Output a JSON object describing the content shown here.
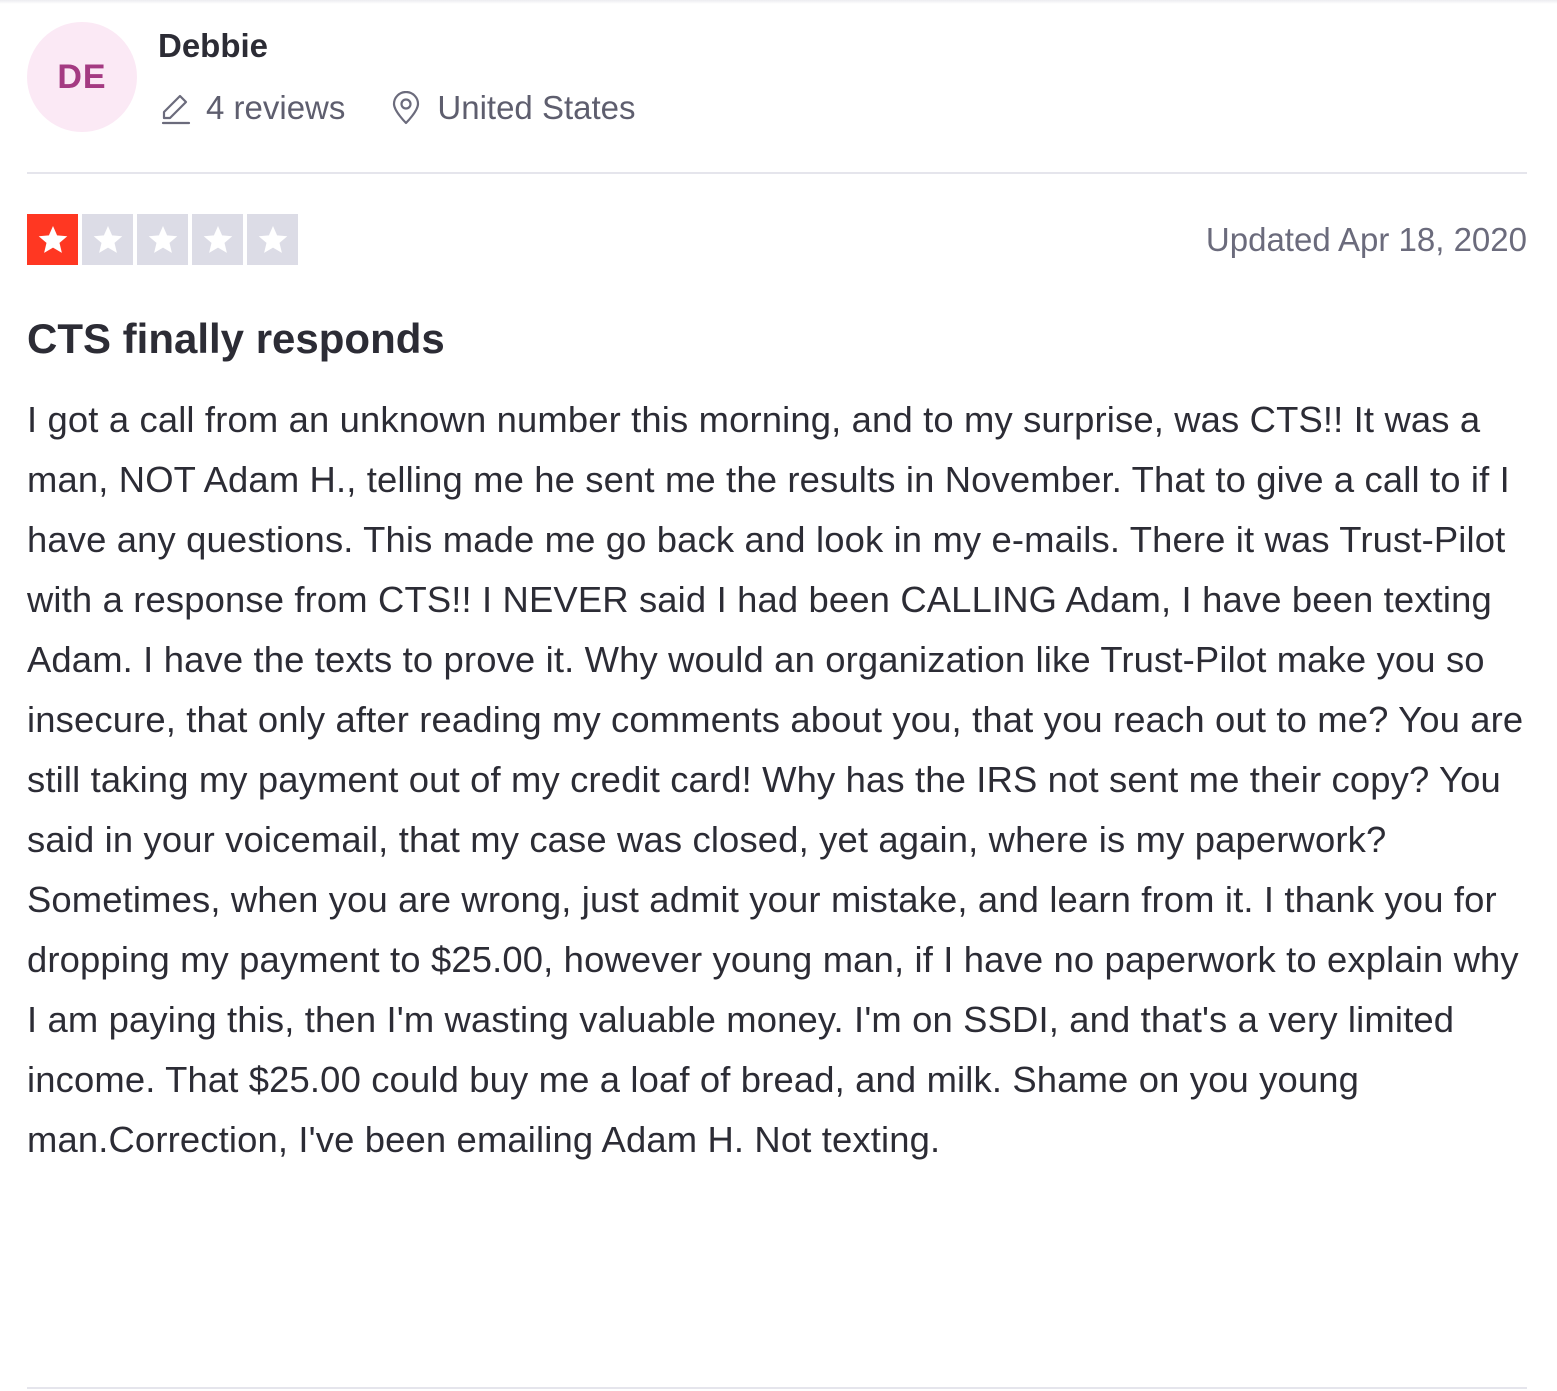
{
  "consumer": {
    "initials": "DE",
    "name": "Debbie",
    "reviews_count": "4 reviews",
    "location": "United States",
    "avatar_bg": "#fbe9f5",
    "avatar_fg": "#a43a82"
  },
  "review": {
    "rating": 1,
    "max_rating": 5,
    "star_color": "#ff3722",
    "date": "Updated Apr 18, 2020",
    "title": "CTS finally responds",
    "body": "I got a call from an unknown number this morning, and to my surprise, was CTS!! It was a man, NOT Adam H., telling me he sent me the results in November. That to give a call to if I have any questions. This made me go back and look in my e-mails. There it was Trust-Pilot with a response from CTS!! I NEVER said I had been CALLING Adam, I have been texting Adam. I have the texts to prove it. Why would an organization like Trust-Pilot make you so insecure, that only after reading my comments about you, that you reach out to me? You are still taking my payment out of my credit card! Why has the IRS not sent me their copy? You said in your voicemail, that my case was closed, yet again, where is my paperwork? Sometimes, when you are wrong, just admit your mistake, and learn from it. I thank you for dropping my payment to $25.00, however young man, if I have no paperwork to explain why I am paying this, then I'm wasting valuable money. I'm on SSDI, and that's a very limited income. That $25.00 could buy me a loaf of bread, and milk. Shame on you young man.Correction, I've been emailing Adam H. Not texting."
  },
  "icons": {
    "reviews": "pencil-icon",
    "location": "location-pin-icon",
    "star": "star-icon"
  }
}
